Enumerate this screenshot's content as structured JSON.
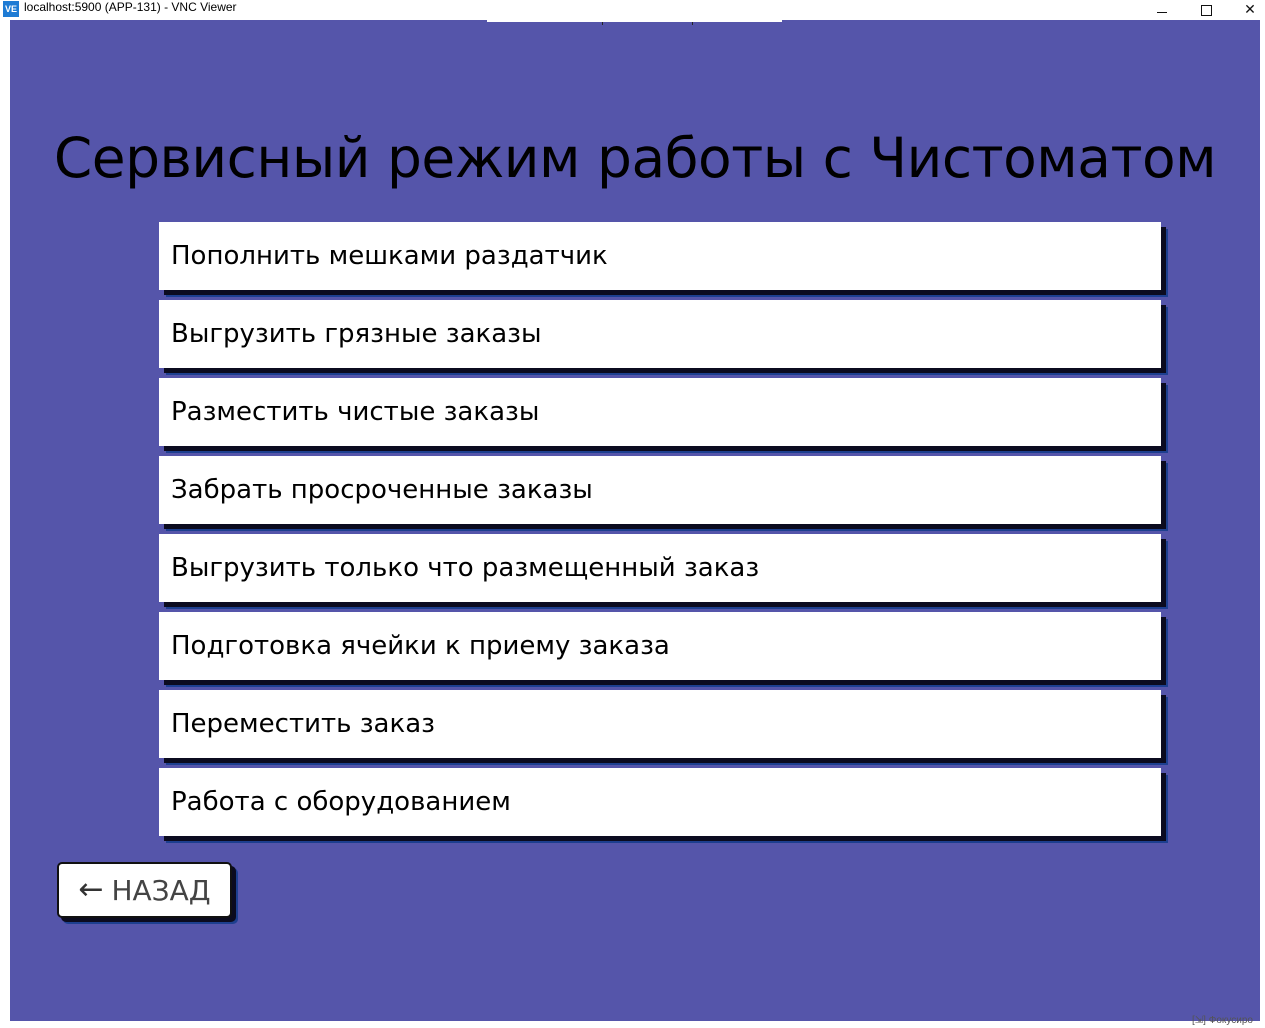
{
  "window": {
    "title": "localhost:5900 (APP-131) - VNC Viewer",
    "app_icon_label": "VE",
    "controls": {
      "minimize_icon": "minimize-icon",
      "maximize_icon": "maximize-icon",
      "close_glyph": "✕"
    }
  },
  "screen": {
    "title": "Сервисный режим работы с Чистоматом",
    "background_color": "#5555aa",
    "menu_items": [
      {
        "label": "Пополнить мешками раздатчик"
      },
      {
        "label": "Выгрузить грязные заказы"
      },
      {
        "label": "Разместить чистые заказы"
      },
      {
        "label": "Забрать просроченные заказы"
      },
      {
        "label": "Выгрузить только что размещенный заказ"
      },
      {
        "label": "Подготовка ячейки к приему заказа"
      },
      {
        "label": "Переместить заказ"
      },
      {
        "label": "Работа с оборудованием"
      }
    ],
    "back_button": {
      "arrow": "←",
      "label": "НАЗАД"
    }
  },
  "status": {
    "focus_hint": "[⇲] Фокусиро"
  }
}
